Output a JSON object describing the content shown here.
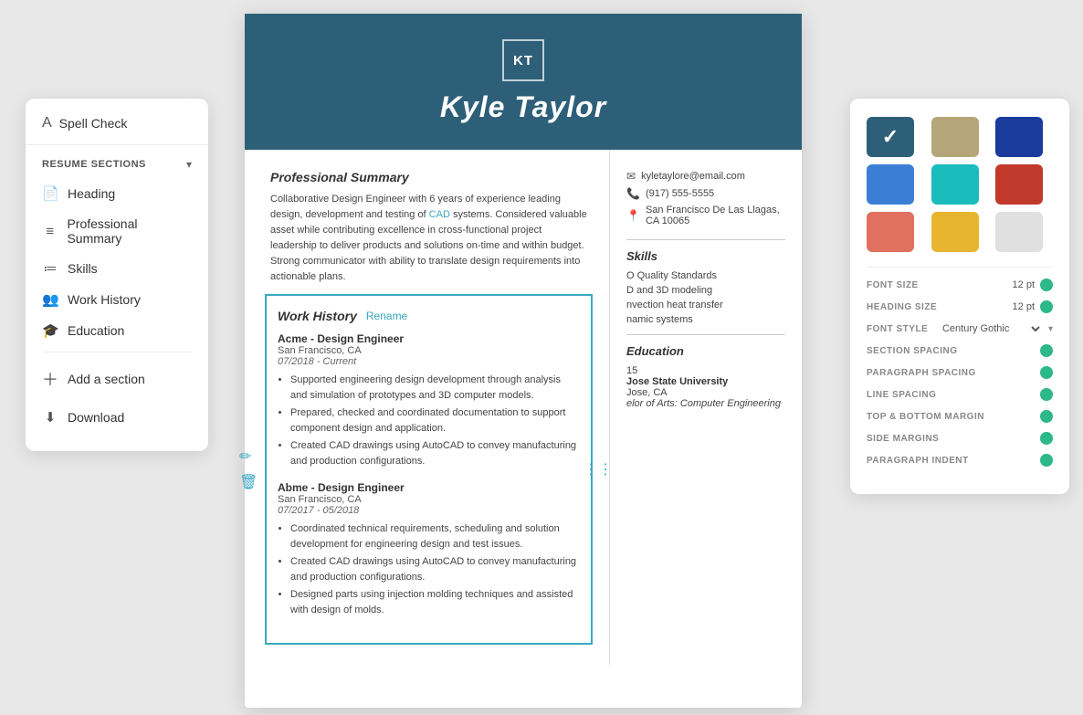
{
  "sidebar": {
    "spell_check_label": "Spell Check",
    "sections_title": "RESUME SECTIONS",
    "items": [
      {
        "id": "heading",
        "label": "Heading",
        "icon": "📄"
      },
      {
        "id": "professional-summary",
        "label": "Professional Summary",
        "icon": "≡"
      },
      {
        "id": "skills",
        "label": "Skills",
        "icon": "≔"
      },
      {
        "id": "work-history",
        "label": "Work History",
        "icon": "👥"
      },
      {
        "id": "education",
        "label": "Education",
        "icon": "🎓"
      }
    ],
    "add_section_label": "Add a section",
    "download_label": "Download"
  },
  "resume": {
    "monogram": "KT",
    "name": "Kyle Taylor",
    "contact": {
      "email": "kyletaylore@email.com",
      "phone": "(917) 555-5555",
      "address": "San Francisco De Las Llagas, CA 10065"
    },
    "professional_summary": {
      "title": "Professional Summary",
      "text": "Collaborative Design Engineer with 6 years of experience leading design, development and testing of CAD systems. Considered valuable asset while contributing excellence in cross-functional project leadership to deliver products and solutions on-time and within budget. Strong communicator with ability to translate design requirements into actionable plans.",
      "highlight_word": "CAD"
    },
    "skills": {
      "title": "Skills",
      "items": [
        "O Quality Standards",
        "D and 3D modeling",
        "nvection heat transfer",
        "namic systems"
      ]
    },
    "work_history": {
      "title": "Work History",
      "rename_label": "Rename",
      "jobs": [
        {
          "company": "Acme - Design Engineer",
          "location": "San Francisco, CA",
          "dates": "07/2018 - Current",
          "bullets": [
            "Supported engineering design development through analysis and simulation of prototypes and 3D computer models.",
            "Prepared, checked and coordinated documentation to support component design and application.",
            "Created CAD drawings using AutoCAD to convey manufacturing and production configurations."
          ]
        },
        {
          "company": "Abme - Design Engineer",
          "location": "San Francisco, CA",
          "dates": "07/2017 - 05/2018",
          "bullets": [
            "Coordinated technical requirements, scheduling and solution development for engineering design and test issues.",
            "Created CAD drawings using AutoCAD to convey manufacturing and production configurations.",
            "Designed parts using injection molding techniques and assisted with design of molds."
          ]
        }
      ]
    },
    "education": {
      "title": "Education",
      "year": "15",
      "school": "Jose State University",
      "location": "Jose, CA",
      "degree": "elor of Arts: Computer Engineering"
    }
  },
  "color_panel": {
    "colors": [
      {
        "id": "teal-dark",
        "hex": "#2e5f78",
        "selected": true
      },
      {
        "id": "tan",
        "hex": "#b5a67a",
        "selected": false
      },
      {
        "id": "navy",
        "hex": "#1a3a9c",
        "selected": false
      },
      {
        "id": "blue",
        "hex": "#3a7fd5",
        "selected": false
      },
      {
        "id": "teal",
        "hex": "#1abcbc",
        "selected": false
      },
      {
        "id": "red",
        "hex": "#c0392b",
        "selected": false
      },
      {
        "id": "salmon",
        "hex": "#e07060",
        "selected": false
      },
      {
        "id": "yellow",
        "hex": "#e8b530",
        "selected": false
      },
      {
        "id": "light",
        "hex": "#e0e0e0",
        "selected": false
      }
    ],
    "font_settings": [
      {
        "label": "FONT SIZE",
        "value": "12 pt",
        "has_toggle": true,
        "toggle_color": "green"
      },
      {
        "label": "HEADING SIZE",
        "value": "12 pt",
        "has_toggle": true,
        "toggle_color": "green"
      },
      {
        "label": "FONT STYLE",
        "value": "Century Gothic",
        "is_select": true
      },
      {
        "label": "SECTION SPACING",
        "value": "",
        "has_toggle": true,
        "toggle_color": "green"
      },
      {
        "label": "PARAGRAPH SPACING",
        "value": "",
        "has_toggle": true,
        "toggle_color": "green"
      },
      {
        "label": "LINE SPACING",
        "value": "",
        "has_toggle": true,
        "toggle_color": "green"
      },
      {
        "label": "TOP & BOTTOM MARGIN",
        "value": "",
        "has_toggle": true,
        "toggle_color": "green"
      },
      {
        "label": "SIDE MARGINS",
        "value": "",
        "has_toggle": true,
        "toggle_color": "green"
      },
      {
        "label": "PARAGRAPH INDENT",
        "value": "",
        "has_toggle": true,
        "toggle_color": "green"
      }
    ]
  }
}
